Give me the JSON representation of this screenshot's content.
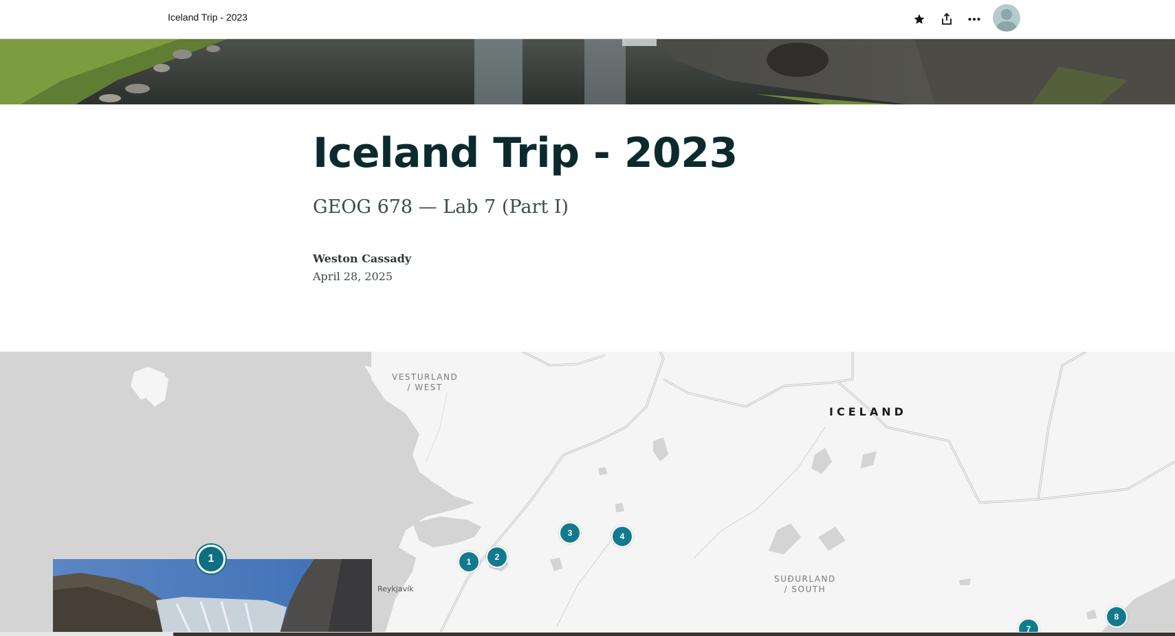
{
  "header": {
    "doc_title": "Iceland Trip - 2023",
    "favorite_icon": "star-icon",
    "share_icon": "share-icon",
    "more_icon": "more-horizontal-icon",
    "avatar_icon": "user-avatar-icon"
  },
  "story": {
    "title": "Iceland Trip - 2023",
    "subtitle": "GEOG 678 — Lab 7 (Part I)",
    "author": "Weston Cassady",
    "date": "April 28, 2025"
  },
  "map": {
    "labels": {
      "west": "VESTURLAND\n/ WEST",
      "country": "ICELAND",
      "south": "SUÐURLAND\n/ SOUTH",
      "city": "Reykjavík"
    },
    "markers": [
      "1",
      "2",
      "3",
      "4",
      "7",
      "8"
    ],
    "active_marker": "1"
  },
  "colors": {
    "marker": "#127a8e",
    "title": "#0a2a2e",
    "land": "#f5f5f5",
    "water": "#d4d4d4"
  }
}
